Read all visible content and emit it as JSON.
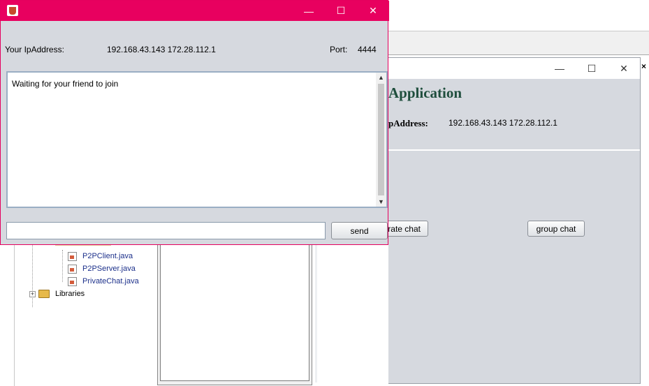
{
  "chat_window": {
    "minimize_glyph": "—",
    "maximize_glyph": "☐",
    "close_glyph": "✕",
    "ip_label": "Your IpAddress:",
    "ip_value": "192.168.43.143  172.28.112.1",
    "port_label": "Port:",
    "port_value": "4444",
    "chat_text": "Waiting for your friend to join",
    "message_value": "",
    "send_label": "send",
    "titlebar_color": "#e8005f",
    "icon": "java-icon"
  },
  "app_window": {
    "minimize_glyph": "—",
    "maximize_glyph": "☐",
    "close_glyph": "✕",
    "heading": "Application",
    "ip_label": "pAddress:",
    "ip_value": "192.168.43.143  172.28.112.1",
    "private_chat_label": "rate chat",
    "group_chat_label": "group chat",
    "heading_color": "#1f4e3d"
  },
  "ide": {
    "tree_items": [
      {
        "label": "P2PClient.java",
        "icon": "java-file-icon"
      },
      {
        "label": "P2PServer.java",
        "icon": "java-file-icon"
      },
      {
        "label": "PrivateChat.java",
        "icon": "java-file-icon"
      }
    ],
    "libraries_label": "Libraries",
    "libraries_expander": "+",
    "right_close_glyph": "×"
  }
}
